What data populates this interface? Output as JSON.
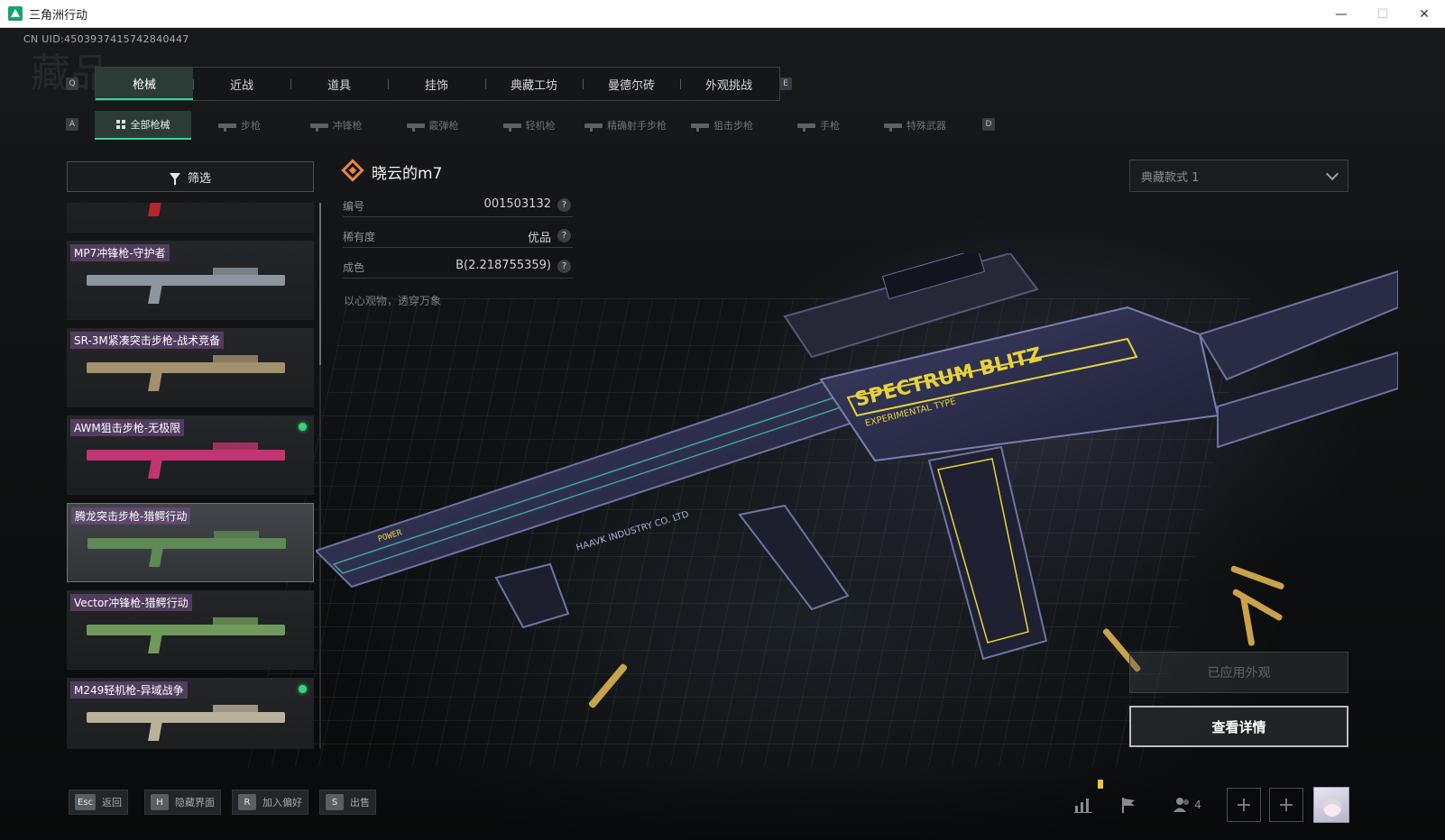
{
  "window": {
    "title": "三角洲行动",
    "minimize": "—",
    "maximize": "☐",
    "close": "✕"
  },
  "uid": "CN UID:4503937415742840447",
  "watermark": "藏品",
  "tab_keys": {
    "prev_main": "Q",
    "next_main": "E",
    "prev_sub": "A",
    "next_sub": "D"
  },
  "main_tabs": [
    {
      "label": "枪械",
      "active": true
    },
    {
      "label": "近战",
      "active": false
    },
    {
      "label": "道具",
      "active": false
    },
    {
      "label": "挂饰",
      "active": false
    },
    {
      "label": "典藏工坊",
      "active": false
    },
    {
      "label": "曼德尔砖",
      "active": false
    },
    {
      "label": "外观挑战",
      "active": false
    }
  ],
  "sub_tabs": [
    {
      "label": "全部枪械",
      "active": true
    },
    {
      "label": "步枪",
      "active": false
    },
    {
      "label": "冲锋枪",
      "active": false
    },
    {
      "label": "霰弹枪",
      "active": false
    },
    {
      "label": "轻机枪",
      "active": false
    },
    {
      "label": "精确射手步枪",
      "active": false
    },
    {
      "label": "狙击步枪",
      "active": false
    },
    {
      "label": "手枪",
      "active": false
    },
    {
      "label": "特殊武器",
      "active": false
    }
  ],
  "filter": {
    "label": "筛选"
  },
  "skins": [
    {
      "label": "",
      "equipped": false,
      "selected": false,
      "color": "#b8262c"
    },
    {
      "label": "MP7冲锋枪-守护者",
      "equipped": false,
      "selected": false,
      "color": "#8d96a0"
    },
    {
      "label": "SR-3M紧凑突击步枪-战术竞备",
      "equipped": false,
      "selected": false,
      "color": "#a3916e"
    },
    {
      "label": "AWM狙击步枪-无极限",
      "equipped": true,
      "selected": false,
      "color": "#c2346f"
    },
    {
      "label": "腾龙突击步枪-猎鳄行动",
      "equipped": false,
      "selected": true,
      "color": "#5e8a55"
    },
    {
      "label": "Vector冲锋枪-猎鳄行动",
      "equipped": false,
      "selected": false,
      "color": "#6f9a5c"
    },
    {
      "label": "M249轻机枪-异域战争",
      "equipped": true,
      "selected": false,
      "color": "#b9b19a"
    }
  ],
  "detail": {
    "name": "晓云的m7",
    "rarity_color": "#e8864a",
    "rows": [
      {
        "key": "编号",
        "value": "001503132",
        "help": "?"
      },
      {
        "key": "稀有度",
        "value": "优品",
        "help": "?"
      },
      {
        "key": "成色",
        "value": "B(2.218755359)",
        "help": "?"
      }
    ],
    "slogan": "以心观物，透穿万象"
  },
  "weapon_decals": {
    "brand": "SPECTRUM BLITZ",
    "type": "EXPERIMENTAL TYPE",
    "maker": "HAAVK INDUSTRY CO. LTD",
    "power": "POWER"
  },
  "preset": {
    "label": "典藏款式 1"
  },
  "applied_button": "已应用外观",
  "detail_button": "查看详情",
  "hints": [
    {
      "key": "Esc",
      "label": "返回"
    },
    {
      "key": "H",
      "label": "隐藏界面"
    },
    {
      "key": "R",
      "label": "加入偏好"
    },
    {
      "key": "S",
      "label": "出售"
    }
  ],
  "tray": {
    "party_count": "4",
    "plus": "+"
  },
  "colors": {
    "accent": "#3bd39a",
    "equipped": "#36d47d",
    "weapon_glow": "#e8d23a"
  }
}
